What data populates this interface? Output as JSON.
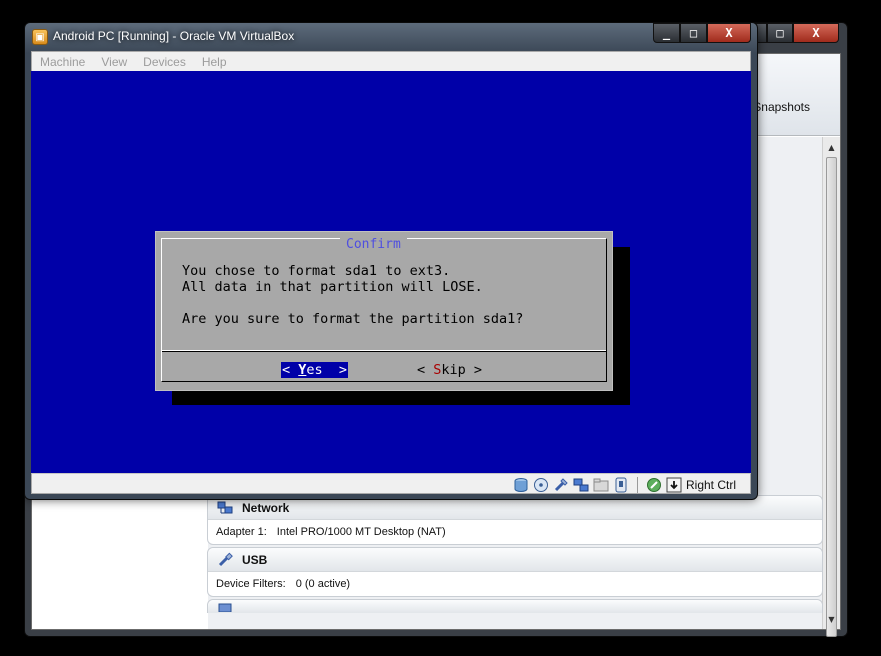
{
  "manager": {
    "toolbar": {
      "snapshots_label": "Snapshots"
    },
    "sections": [
      {
        "title": "Network",
        "icon": "network-icon",
        "rows": [
          {
            "key": "Adapter 1:",
            "value": "Intel PRO/1000 MT Desktop (NAT)"
          }
        ]
      },
      {
        "title": "USB",
        "icon": "usb-icon",
        "rows": [
          {
            "key": "Device Filters:",
            "value": "0 (0 active)"
          }
        ]
      }
    ],
    "caption": {
      "minimize": "_",
      "maximize": "□",
      "close": "X"
    }
  },
  "vm_window": {
    "title": "Android PC [Running] - Oracle VM VirtualBox",
    "caption": {
      "minimize": "_",
      "maximize": "□",
      "close": "X"
    },
    "menu": [
      "Machine",
      "View",
      "Devices",
      "Help"
    ],
    "status": {
      "icons": [
        "hard-disk-icon",
        "optical-drive-icon",
        "usb-device-icon",
        "network-adapter-icon",
        "shared-folder-icon",
        "capture-icon",
        "mouse-integration-icon",
        "keyboard-capture-icon"
      ],
      "host_key": "Right Ctrl"
    }
  },
  "dialog": {
    "title": "Confirm",
    "lines": [
      "You chose to format sda1 to ext3.",
      "All data in that partition will LOSE.",
      "Are you sure to format the partition sda1?"
    ],
    "yes": {
      "left": "< ",
      "hotkey": "Y",
      "rest": "es  >"
    },
    "skip": {
      "left": "< ",
      "hotkey": "S",
      "rest": "kip >"
    }
  },
  "colors": {
    "screen_bg": "#0000a8",
    "dialog_bg": "#a8a8a8",
    "dialog_title": "#4f4fe0",
    "hotkey_red": "#a80000"
  }
}
